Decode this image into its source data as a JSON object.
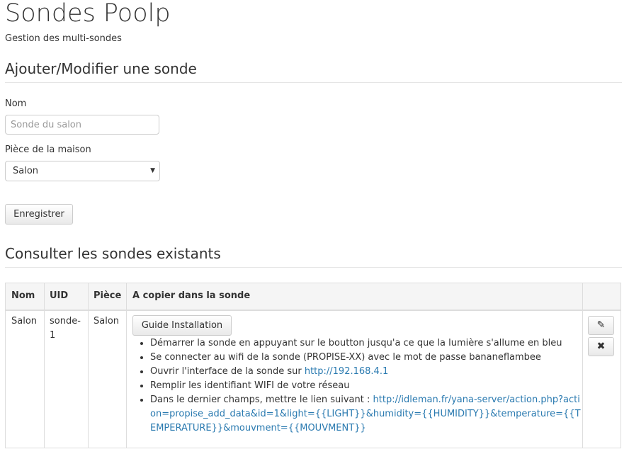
{
  "header": {
    "title": "Sondes Poolp",
    "subtitle": "Gestion des multi-sondes"
  },
  "form": {
    "section_title": "Ajouter/Modifier une sonde",
    "name_label": "Nom",
    "name_placeholder": "Sonde du salon",
    "name_value": "",
    "room_label": "Pièce de la maison",
    "room_selected": "Salon",
    "save_label": "Enregistrer"
  },
  "list": {
    "section_title": "Consulter les sondes existants",
    "columns": [
      "Nom",
      "UID",
      "Pièce",
      "A copier dans la sonde",
      ""
    ],
    "rows": [
      {
        "name": "Salon",
        "uid_line1": "sonde-",
        "uid_line2": "1",
        "room": "Salon",
        "guide_label": "Guide Installation",
        "steps": {
          "s1": "Démarrer la sonde en appuyant sur le boutton jusqu'a ce que la lumière s'allume en bleu",
          "s2": "Se connecter au wifi de la sonde (PROPISE-XX) avec le mot de passe bananeflambee",
          "s3_text": "Ouvrir l'interface de la sonde sur ",
          "s3_link": "http://192.168.4.1",
          "s4": "Remplir les identifiant WIFI de votre réseau",
          "s5_text": "Dans le dernier champs, mettre le lien suivant : ",
          "s5_link": "http://idleman.fr/yana-server/action.php?action=propise_add_data&id=1&light={{LIGHT}}&humidity={{HUMIDITY}}&temperature={{TEMPERATURE}}&mouvment={{MOUVMENT}}"
        },
        "actions": {
          "edit_icon": "pencil-icon",
          "delete_icon": "close-icon"
        }
      }
    ]
  },
  "colors": {
    "text": "#333333",
    "link": "#2a7ab0",
    "border": "#dddddd",
    "header_bg": "#f5f5f5"
  }
}
